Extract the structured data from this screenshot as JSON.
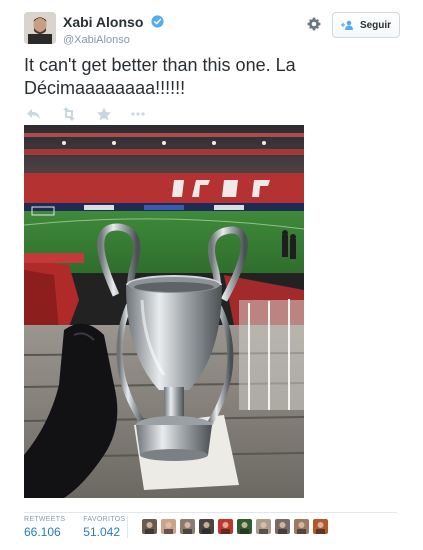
{
  "user": {
    "fullname": "Xabi Alonso",
    "username": "@XabiAlonso",
    "verified": true,
    "avatar": "profile-photo"
  },
  "follow_button": {
    "label": "Seguir",
    "icon": "add-user-icon"
  },
  "settings_icon": "gear-icon",
  "tweet": {
    "text": "It can't get better than this one. La\nDécimaaaaaaaa!!!!!!"
  },
  "actions": [
    {
      "name": "reply-icon"
    },
    {
      "name": "retweet-icon"
    },
    {
      "name": "favorite-icon"
    },
    {
      "name": "more-icon"
    }
  ],
  "media": {
    "type": "photo",
    "description_icon": "trophy-photo"
  },
  "stats": {
    "retweets_label": "RETWEETS",
    "retweets_value": "66.106",
    "favorites_label": "FAVORITOS",
    "favorites_value": "51.042"
  },
  "favoriter_avatars": [
    {
      "name": "avatar-1",
      "color": "#6b5a4e"
    },
    {
      "name": "avatar-2",
      "color": "#c9a48a"
    },
    {
      "name": "avatar-3",
      "color": "#8a7d6e"
    },
    {
      "name": "avatar-4",
      "color": "#4a4440"
    },
    {
      "name": "avatar-5",
      "color": "#c4342c"
    },
    {
      "name": "avatar-6",
      "color": "#2f5d2f"
    },
    {
      "name": "avatar-7",
      "color": "#a89c8c"
    },
    {
      "name": "avatar-8",
      "color": "#7a6a66"
    },
    {
      "name": "avatar-9",
      "color": "#9c7b64"
    },
    {
      "name": "avatar-10",
      "color": "#b5562d"
    }
  ],
  "colors": {
    "link": "#2b7bb9",
    "muted": "#8899a6",
    "text": "#292f33",
    "verified": "#55acee"
  }
}
